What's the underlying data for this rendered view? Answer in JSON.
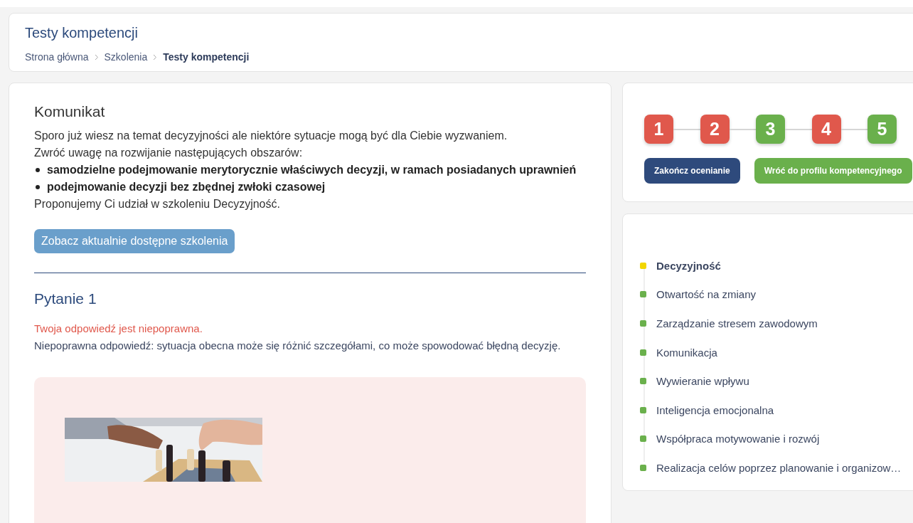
{
  "header": {
    "title": "Testy kompetencji",
    "breadcrumb": [
      {
        "label": "Strona główna",
        "current": false
      },
      {
        "label": "Szkolenia",
        "current": false
      },
      {
        "label": "Testy kompetencji",
        "current": true
      }
    ]
  },
  "message": {
    "title": "Komunikat",
    "lines": [
      "Sporo już wiesz na temat decyzyjności ale niektóre sytuacje mogą być dla Ciebie wyzwaniem.",
      "Zwróć uwagę na rozwijanie następujących obszarów:"
    ],
    "bullets": [
      "samodzielne podejmowanie merytorycznie właściwych decyzji, w ramach posiadanych uprawnień",
      "podejmowanie decyzji bez zbędnej zwłoki czasowej"
    ],
    "closing": "Proponujemy Ci udział w szkoleniu Decyzyjność.",
    "button": "Zobacz aktualnie dostępne szkolenia"
  },
  "question": {
    "title": "Pytanie 1",
    "correct": false,
    "verdict": "Twoja odpowiedź jest niepoprawna.",
    "explanation": "Niepoprawna odpowiedź: sytuacja obecna może się różnić szczegółami, co może spowodować błędną decyzję."
  },
  "steps": [
    {
      "label": "1",
      "correct": false
    },
    {
      "label": "2",
      "correct": false
    },
    {
      "label": "3",
      "correct": true
    },
    {
      "label": "4",
      "correct": false
    },
    {
      "label": "5",
      "correct": true
    }
  ],
  "actions": [
    {
      "label": "Zakończ ocenianie",
      "kind": "primary"
    },
    {
      "label": "Wróć do profilu kompetencyjnego",
      "kind": "success"
    }
  ],
  "competencies": [
    {
      "label": "Decyzyjność",
      "selected": true,
      "color": "#f2d600"
    },
    {
      "label": "Otwartość na zmiany",
      "selected": false,
      "color": "#6ab04c"
    },
    {
      "label": "Zarządzanie stresem zawodowym",
      "selected": false,
      "color": "#6ab04c"
    },
    {
      "label": "Komunikacja",
      "selected": false,
      "color": "#6ab04c"
    },
    {
      "label": "Wywieranie wpływu",
      "selected": false,
      "color": "#6ab04c"
    },
    {
      "label": "Inteligencja emocjonalna",
      "selected": false,
      "color": "#6ab04c"
    },
    {
      "label": "Współpraca motywowanie i rozwój",
      "selected": false,
      "color": "#6ab04c"
    },
    {
      "label": "Realizacja celów poprzez planowanie i organizow…",
      "selected": false,
      "color": "#6ab04c"
    }
  ]
}
